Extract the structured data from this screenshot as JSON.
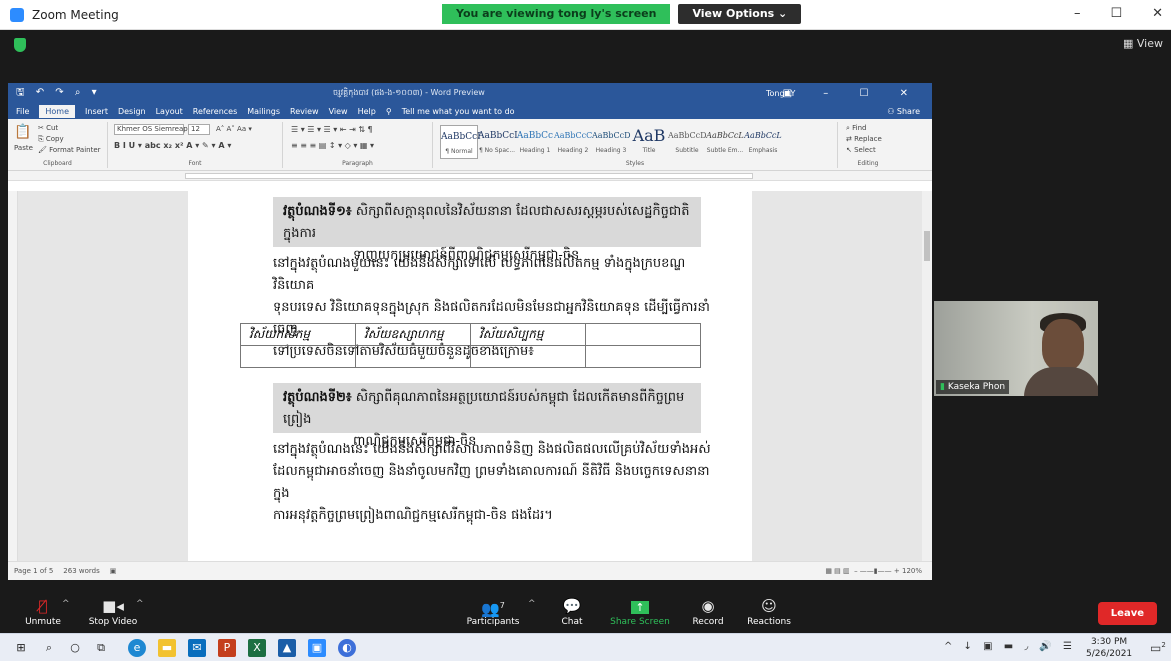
{
  "zoom": {
    "window_title": "Zoom Meeting",
    "viewing_banner": "You are viewing tong ly's screen",
    "view_options": "View Options ⌄",
    "view_button": "View",
    "controls": {
      "minimize": "–",
      "maximize": "☐",
      "close": "✕"
    }
  },
  "word": {
    "quick_access": "🖫 ↶ ↷ ⌕ ▾",
    "doc_title": "ចរ្មុវគ្គិកុងបាវ (ផង-ង-១០០៣) - Word Preview",
    "user": "Tong LY",
    "menu": [
      "File",
      "Home",
      "Insert",
      "Design",
      "Layout",
      "References",
      "Mailings",
      "Review",
      "View",
      "Help",
      "Tell me what you want to do"
    ],
    "share": "Share",
    "ribbon": {
      "paste": "Paste",
      "cut": "Cut",
      "copy": "Copy",
      "format_painter": "Format Painter",
      "clipboard": "Clipboard",
      "font_name": "Khmer OS Siemreap",
      "font_size": "12",
      "font_label": "Font",
      "paragraph_label": "Paragraph",
      "styles_label": "Styles",
      "editing_label": "Editing",
      "find": "Find",
      "replace": "Replace",
      "select": "Select",
      "styles": [
        {
          "preview": "AaBbCcI",
          "name": "¶ Normal"
        },
        {
          "preview": "AaBbCcI",
          "name": "¶ No Spac..."
        },
        {
          "preview": "AaBbCc",
          "name": "Heading 1"
        },
        {
          "preview": "AaBbCcC",
          "name": "Heading 2"
        },
        {
          "preview": "AaBbCcD",
          "name": "Heading 3"
        },
        {
          "preview": "AaB",
          "name": "Title"
        },
        {
          "preview": "AaBbCcD",
          "name": "Subtitle"
        },
        {
          "preview": "AaBbCcL",
          "name": "Subtle Em..."
        },
        {
          "preview": "AaBbCcL",
          "name": "Emphasis"
        }
      ]
    },
    "status": {
      "page": "Page 1 of 5",
      "words": "263 words",
      "zoom": "120%"
    },
    "content": {
      "heading1": {
        "label": "វត្ថុបំណងទី១៖",
        "text": "សិក្សាពីសក្តានុពលនៃវិស័យនានា ដែលជាសសរស្តម្ភរបស់សេដ្ឋកិច្ចជាតិក្នុងការ",
        "text2": "ទាញយកប្រយោជន៍ពីពាណិជ្ជកម្មសេរីកម្ពុជា-ចិន"
      },
      "para1": [
        "នៅក្នុងវត្ថុបំណងមួយនេះ យើងនឹងសិក្សាទៅលើ លទ្ធភាពនៃផលិតកម្ម ទាំងក្នុងក្របខណ្ឌវិនិយោគ",
        "ទុនបរទេស វិនិយោគទុនក្នុងស្រុក និងផលិតករដែលមិនមែនជាអ្នកវិនិយោគទុន ដើម្បីធ្វើការនាំចេញ",
        "ទៅប្រទេសចិនទៅតាមវិស័យធំមួយចំនួនដូចខាងក្រោម៖"
      ],
      "table_headers": [
        "វិស័យកសិកម្ម",
        "វិស័យឧស្សាហកម្ម",
        "វិស័យសិប្បកម្ម",
        ""
      ],
      "heading2": {
        "label": "វត្ថុបំណងទី២៖",
        "text": "សិក្សាពីគុណភាពនៃអត្ថប្រយោជន៍របស់កម្ពុជា ដែលកើតមានពីកិច្ចព្រមព្រៀង",
        "text2": "ពាណិជ្ជកម្មសេរីកម្ពុជា-ចិន"
      },
      "para2": [
        "នៅក្នុងវត្ថុបំណងនេះ  យើងនឹងសិក្សាពីវិសាលភាពទំនិញ  និងផលិតផលលើគ្រប់វិស័យទាំងអស់",
        "ដែលកម្ពុជាអាចនាំចេញ និងនាំចូលមកវិញ ព្រមទាំងគោលការណ៍ នីតិវិធី និងបច្ចេកទេសនានាក្នុង",
        "ការអនុវត្តកិច្ចព្រមព្រៀងពាណិជ្ជកម្មសេរីកម្ពុជា-ចិន ផងដែរ។"
      ]
    }
  },
  "participant": {
    "name": "Kaseka Phon"
  },
  "toolbar": {
    "unmute": "Unmute",
    "stop_video": "Stop Video",
    "participants": "Participants",
    "participants_count": "7",
    "chat": "Chat",
    "share_screen": "Share Screen",
    "record": "Record",
    "reactions": "Reactions",
    "leave": "Leave"
  },
  "taskbar": {
    "time": "3:30 PM",
    "date": "5/26/2021",
    "notifications": "2"
  }
}
